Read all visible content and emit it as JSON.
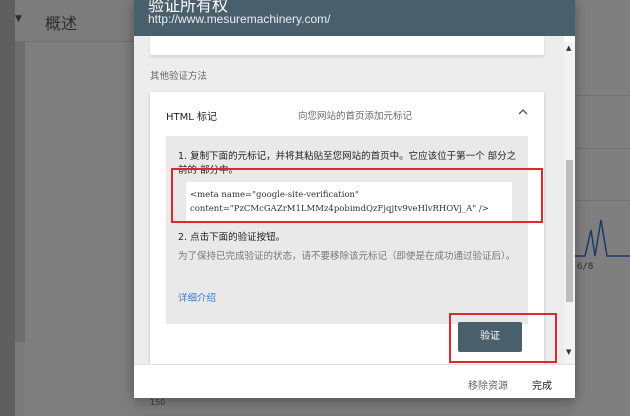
{
  "background": {
    "nav_title": "概述",
    "chart_date": "6/8",
    "bottom_number": "150"
  },
  "dialog": {
    "title": "验证所有权",
    "url": "http://www.mesuremachinery.com/",
    "other_methods_label": "其他验证方法",
    "html_tag": {
      "title": "HTML 标记",
      "subtitle": "向您网站的首页添加元标记",
      "step1": "1. 复制下面的元标记，并将其粘贴至您网站的首页中。它应该位于第一个 部分之前的 部分中。",
      "meta_code_line1": "<meta name=\"google-site-verification\"",
      "meta_code_line2": "content=\"PzCMcGAZrM1LMMz4pobimdQzFjqjtv9veHlvRHOVj_A\" />",
      "step2": "2. 点击下面的验证按钮。",
      "note": "为了保持已完成验证的状态，请不要移除该元标记（即使是在成功通过验证后）。",
      "details_link": "详细介绍"
    },
    "verify_button": "验证",
    "footer": {
      "remove": "移除资源",
      "done": "完成"
    }
  },
  "colors": {
    "header": "#4a5f6c",
    "annotation_red": "#e3262c",
    "link": "#3a76d9"
  }
}
